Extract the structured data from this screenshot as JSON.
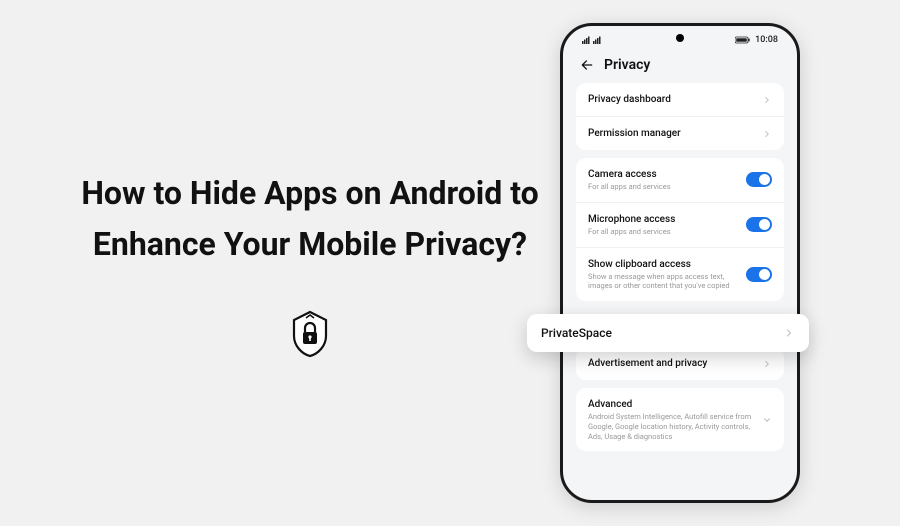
{
  "heading": "How to Hide Apps on Android to Enhance Your Mobile Privacy?",
  "logo_name": "lock-info-logo",
  "status": {
    "time": "10:08"
  },
  "header": {
    "title": "Privacy"
  },
  "rows": {
    "dashboard": {
      "title": "Privacy dashboard"
    },
    "permission": {
      "title": "Permission manager"
    },
    "camera": {
      "title": "Camera access",
      "sub": "For all apps and services",
      "toggle": true
    },
    "mic": {
      "title": "Microphone access",
      "sub": "For all apps and services",
      "toggle": true
    },
    "clipboard": {
      "title": "Show clipboard access",
      "sub": "Show a message when apps access text, images or other content that you've copied",
      "toggle": true
    },
    "private_space": {
      "title": "PrivateSpace"
    },
    "ads": {
      "title": "Advertisement and privacy"
    },
    "advanced": {
      "title": "Advanced",
      "sub": "Android System Intelligence, Autofill service from Google, Google location history, Activity controls, Ads, Usage & diagnostics"
    }
  }
}
